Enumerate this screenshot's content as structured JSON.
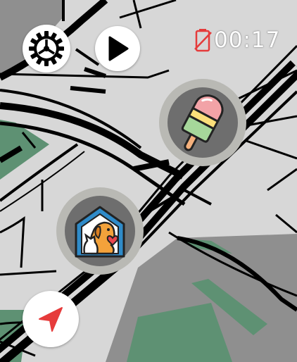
{
  "status": {
    "timer": "00:17",
    "battery_icon": "battery-empty-icon",
    "alert_color": "#e53b3b"
  },
  "controls": {
    "settings_icon": "gear-icon",
    "play_icon": "play-icon",
    "locate_icon": "navigation-arrow-icon",
    "locate_color": "#e63b3b"
  },
  "markers": [
    {
      "name": "ice-cream-marker",
      "icon": "popsicle-icon"
    },
    {
      "name": "pet-shelter-marker",
      "icon": "pet-house-icon"
    }
  ],
  "map": {
    "background": "#d7d7d7",
    "park_color": "#5e9173",
    "block_color": "#8f8f8f",
    "road_color": "#000000"
  }
}
